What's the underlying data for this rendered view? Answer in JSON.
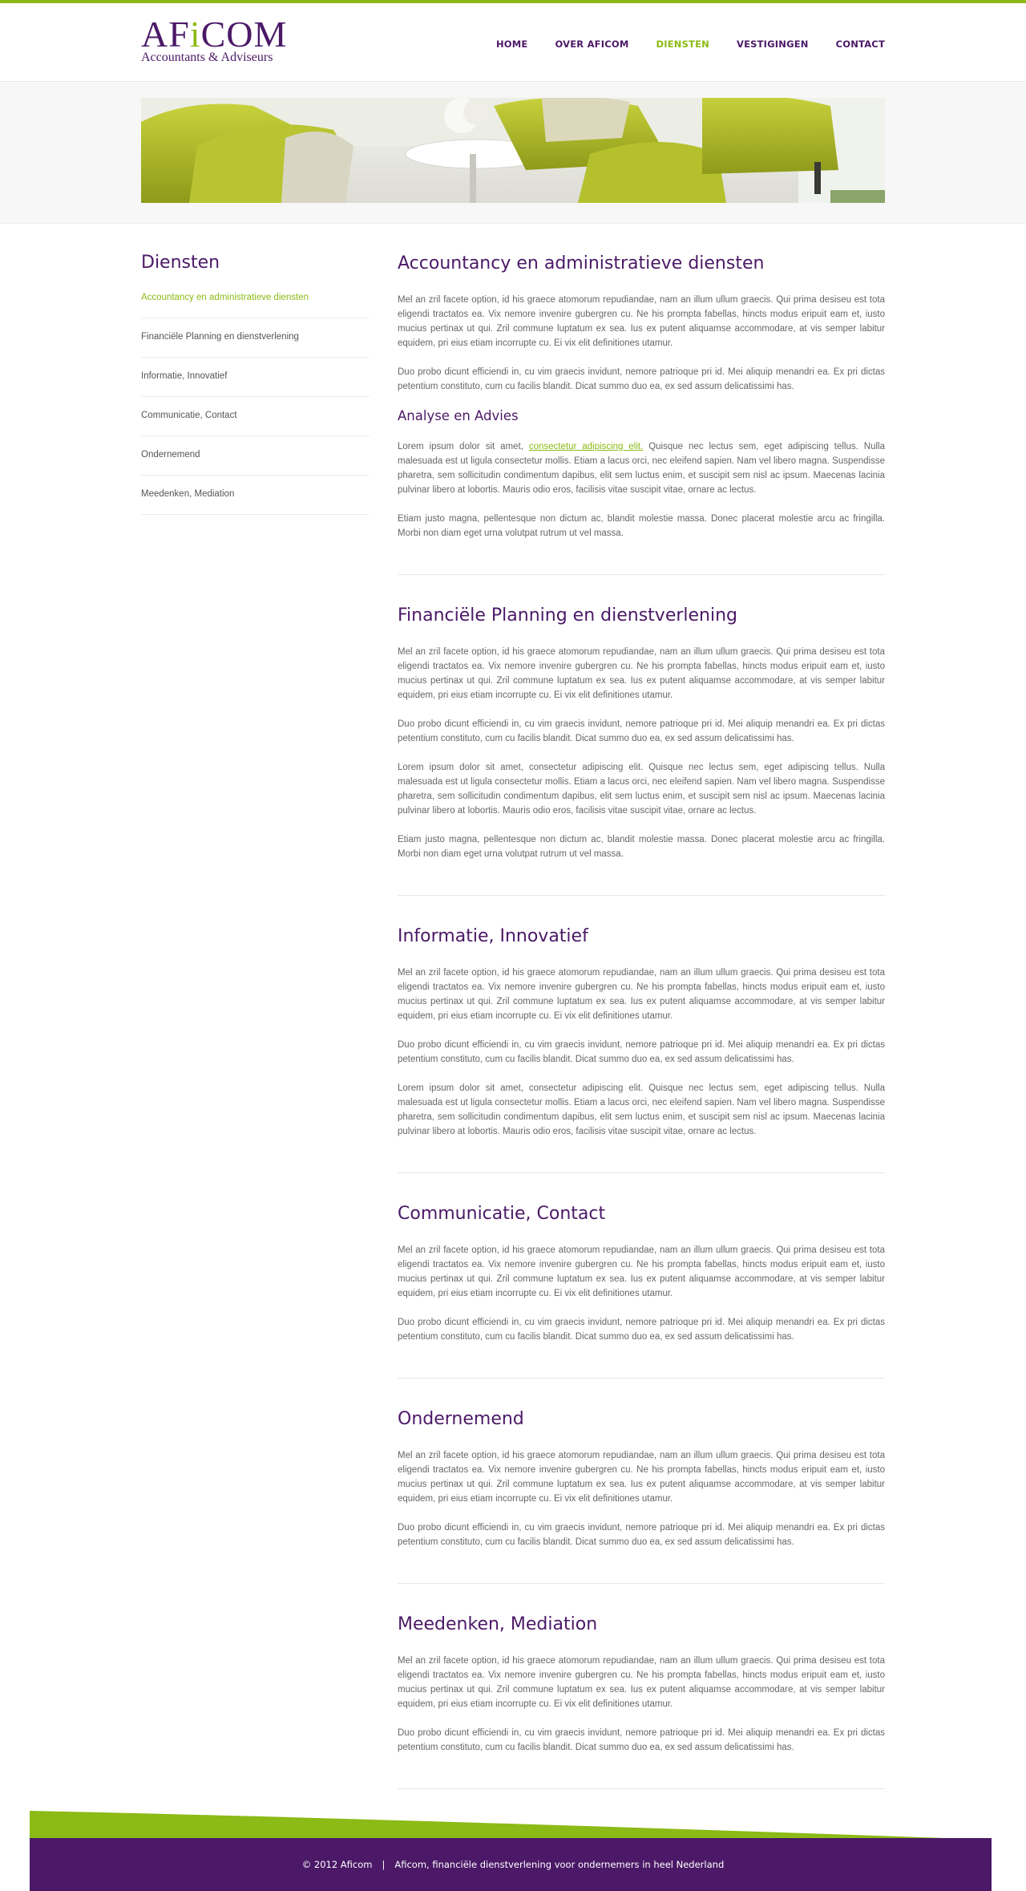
{
  "brand": {
    "name_prefix": "AF",
    "name_i": "i",
    "name_suffix": "COM",
    "tagline": "Accountants & Adviseurs",
    "primary_color": "#4b1967",
    "accent_color": "#8cba16"
  },
  "nav": {
    "items": [
      "HOME",
      "OVER AFICOM",
      "DIENSTEN",
      "VESTIGINGEN",
      "CONTACT"
    ],
    "active": "DIENSTEN"
  },
  "sidebar": {
    "title": "Diensten",
    "items": [
      "Accountancy en administratieve diensten",
      "Financiële Planning en dienstverlening",
      "Informatie, Innovatief",
      "Communicatie, Contact",
      "Ondernemend",
      "Meedenken, Mediation"
    ]
  },
  "sections": {
    "accountancy": {
      "title": "Accountancy en administratieve diensten",
      "p1": "Mel an zril facete option, id his graece atomorum repudiandae, nam an illum ullum graecis. Qui prima desiseu est tota eligendi tractatos ea. Vix nemore invenire gubergren cu. Ne his prompta fabellas, hincts modus eripuit eam et, iusto mucius pertinax ut qui. Zril commune luptatum ex sea. Ius ex putent aliquamse accommodare, at vis semper labitur equidem, pri eius etiam incorrupte cu. Ei vix elit definitiones utamur.",
      "p2": "Duo probo dicunt efficiendi in, cu vim graecis invidunt, nemore patrioque pri id. Mei aliquip menandri ea. Ex pri dictas petentium constituto, cum cu facilis blandit. Dicat summo duo ea, ex sed assum delicatissimi has.",
      "subtitle": "Analyse en Advies",
      "p3_before": "Lorem ipsum dolor sit amet, ",
      "p3_link": "consectetur adipiscing elit.",
      "p3_after": " Quisque nec lectus sem, eget adipiscing tellus. Nulla malesuada est ut ligula consectetur mollis. Etiam a lacus orci, nec eleifend sapien. Nam vel libero magna. Suspendisse pharetra, sem sollicitudin condimentum dapibus, elit sem luctus enim, et suscipit sem nisl ac ipsum. Maecenas lacinia pulvinar libero at lobortis. Mauris odio eros, facilisis vitae suscipit vitae, ornare ac lectus.",
      "p4": "Etiam justo magna, pellentesque non dictum ac, blandit molestie massa. Donec placerat molestie arcu ac fringilla. Morbi non diam eget urna volutpat rutrum ut vel massa."
    },
    "financiele": {
      "title": "Financiële Planning en dienstverlening",
      "p1": "Mel an zril facete option, id his graece atomorum repudiandae, nam an illum ullum graecis. Qui prima desiseu est tota eligendi tractatos ea. Vix nemore invenire gubergren cu. Ne his prompta fabellas, hincts modus eripuit eam et, iusto mucius pertinax ut qui. Zril commune luptatum ex sea. Ius ex putent aliquamse accommodare, at vis semper labitur equidem, pri eius etiam incorrupte cu. Ei vix elit definitiones utamur.",
      "p2": "Duo probo dicunt efficiendi in, cu vim graecis invidunt, nemore patrioque pri id. Mei aliquip menandri ea. Ex pri dictas petentium constituto, cum cu facilis blandit. Dicat summo duo ea, ex sed assum delicatissimi has.",
      "p3": "Lorem ipsum dolor sit amet, consectetur adipiscing elit. Quisque nec lectus sem, eget adipiscing tellus. Nulla malesuada est ut ligula consectetur mollis. Etiam a lacus orci, nec eleifend sapien. Nam vel libero magna. Suspendisse pharetra, sem sollicitudin condimentum dapibus, elit sem luctus enim, et suscipit sem nisl ac ipsum. Maecenas lacinia pulvinar libero at lobortis. Mauris odio eros, facilisis vitae suscipit vitae, ornare ac lectus.",
      "p4": "Etiam justo magna, pellentesque non dictum ac, blandit molestie massa. Donec placerat molestie arcu ac fringilla. Morbi non diam eget urna volutpat rutrum ut vel massa."
    },
    "informatie": {
      "title": "Informatie, Innovatief",
      "p1": "Mel an zril facete option, id his graece atomorum repudiandae, nam an illum ullum graecis. Qui prima desiseu est tota eligendi tractatos ea. Vix nemore invenire gubergren cu. Ne his prompta fabellas, hincts modus eripuit eam et, iusto mucius pertinax ut qui. Zril commune luptatum ex sea. Ius ex putent aliquamse accommodare, at vis semper labitur equidem, pri eius etiam incorrupte cu. Ei vix elit definitiones utamur.",
      "p2": "Duo probo dicunt efficiendi in, cu vim graecis invidunt, nemore patrioque pri id. Mei aliquip menandri ea. Ex pri dictas petentium constituto, cum cu facilis blandit. Dicat summo duo ea, ex sed assum delicatissimi has.",
      "p3": "Lorem ipsum dolor sit amet, consectetur adipiscing elit. Quisque nec lectus sem, eget adipiscing tellus. Nulla malesuada est ut ligula consectetur mollis. Etiam a lacus orci, nec eleifend sapien. Nam vel libero magna. Suspendisse pharetra, sem sollicitudin condimentum dapibus, elit sem luctus enim, et suscipit sem nisl ac ipsum. Maecenas lacinia pulvinar libero at lobortis. Mauris odio eros, facilisis vitae suscipit vitae, ornare ac lectus."
    },
    "communicatie": {
      "title": "Communicatie, Contact",
      "p1": "Mel an zril facete option, id his graece atomorum repudiandae, nam an illum ullum graecis. Qui prima desiseu est tota eligendi tractatos ea. Vix nemore invenire gubergren cu. Ne his prompta fabellas, hincts modus eripuit eam et, iusto mucius pertinax ut qui. Zril commune luptatum ex sea. Ius ex putent aliquamse accommodare, at vis semper labitur equidem, pri eius etiam incorrupte cu. Ei vix elit definitiones utamur.",
      "p2": "Duo probo dicunt efficiendi in, cu vim graecis invidunt, nemore patrioque pri id. Mei aliquip menandri ea. Ex pri dictas petentium constituto, cum cu facilis blandit. Dicat summo duo ea, ex sed assum delicatissimi has."
    },
    "ondernemend": {
      "title": "Ondernemend",
      "p1": "Mel an zril facete option, id his graece atomorum repudiandae, nam an illum ullum graecis. Qui prima desiseu est tota eligendi tractatos ea. Vix nemore invenire gubergren cu. Ne his prompta fabellas, hincts modus eripuit eam et, iusto mucius pertinax ut qui. Zril commune luptatum ex sea. Ius ex putent aliquamse accommodare, at vis semper labitur equidem, pri eius etiam incorrupte cu. Ei vix elit definitiones utamur.",
      "p2": "Duo probo dicunt efficiendi in, cu vim graecis invidunt, nemore patrioque pri id. Mei aliquip menandri ea. Ex pri dictas petentium constituto, cum cu facilis blandit. Dicat summo duo ea, ex sed assum delicatissimi has."
    },
    "meedenken": {
      "title": "Meedenken, Mediation",
      "p1": "Mel an zril facete option, id his graece atomorum repudiandae, nam an illum ullum graecis. Qui prima desiseu est tota eligendi tractatos ea. Vix nemore invenire gubergren cu. Ne his prompta fabellas, hincts modus eripuit eam et, iusto mucius pertinax ut qui. Zril commune luptatum ex sea. Ius ex putent aliquamse accommodare, at vis semper labitur equidem, pri eius etiam incorrupte cu. Ei vix elit definitiones utamur.",
      "p2": "Duo probo dicunt efficiendi in, cu vim graecis invidunt, nemore patrioque pri id. Mei aliquip menandri ea. Ex pri dictas petentium constituto, cum cu facilis blandit. Dicat summo duo ea, ex sed assum delicatissimi has."
    }
  },
  "footer": {
    "copyright": "© 2012 Aficom",
    "separator": "|",
    "tagline": "Aficom, financiële dienstverlening voor ondernemers in heel Nederland"
  }
}
